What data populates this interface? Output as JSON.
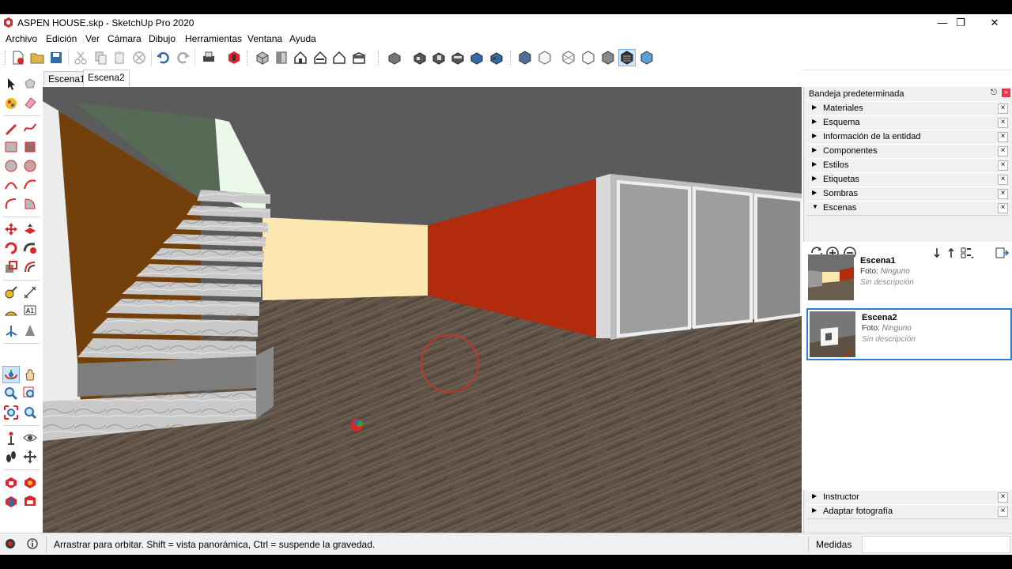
{
  "window": {
    "title": "ASPEN HOUSE.skp - SketchUp Pro 2020",
    "controls": {
      "minimize": "—",
      "restore": "❐",
      "close": "✕"
    }
  },
  "menu": [
    "Archivo",
    "Edición",
    "Ver",
    "Cámara",
    "Dibujo",
    "Herramientas",
    "Ventana",
    "Ayuda"
  ],
  "scene_tabs": [
    {
      "label": "Escena1",
      "active": false
    },
    {
      "label": "Escena2",
      "active": true
    }
  ],
  "tray": {
    "title": "Bandeja predeterminada",
    "panels": [
      {
        "label": "Materiales",
        "expanded": false
      },
      {
        "label": "Esquema",
        "expanded": false
      },
      {
        "label": "Información de la entidad",
        "expanded": false
      },
      {
        "label": "Componentes",
        "expanded": false
      },
      {
        "label": "Estilos",
        "expanded": false
      },
      {
        "label": "Etiquetas",
        "expanded": false
      },
      {
        "label": "Sombras",
        "expanded": false
      },
      {
        "label": "Escenas",
        "expanded": true
      }
    ],
    "bottom_panels": [
      {
        "label": "Instructor",
        "expanded": false
      },
      {
        "label": "Adaptar fotografía",
        "expanded": false
      }
    ],
    "close_glyph": "×",
    "collapsed_arrow": "▶",
    "expanded_arrow": "▼"
  },
  "scenes": [
    {
      "name": "Escena1",
      "foto_label": "Foto:",
      "foto_value": "Ninguno",
      "description": "Sin descripción",
      "selected": false
    },
    {
      "name": "Escena2",
      "foto_label": "Foto:",
      "foto_value": "Ninguno",
      "description": "Sin descripción",
      "selected": true
    }
  ],
  "status": {
    "message": "Arrastrar para orbitar. Shift = vista panorámica, Ctrl = suspende la gravedad.",
    "measurements_label": "Medidas",
    "measurements_value": ""
  },
  "colors": {
    "viewport_sky": "#5b5b5b",
    "floor": "#5e5246",
    "orange_wall": "#b22b0c",
    "cream_wall": "#fde7b1",
    "brown_wall": "#733f0b",
    "green_wall": "#566a55",
    "selection": "#2a7ed6"
  }
}
